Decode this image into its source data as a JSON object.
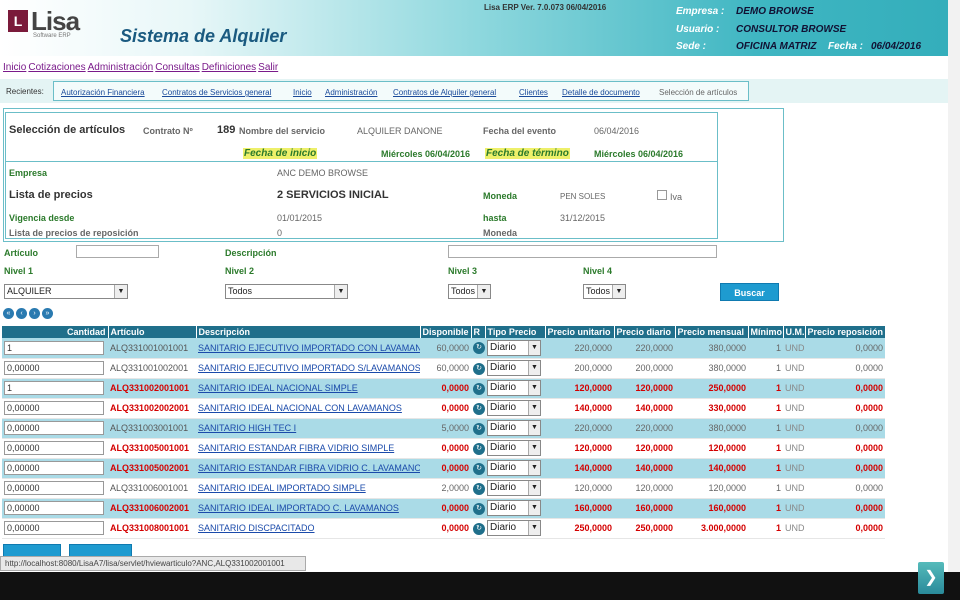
{
  "header": {
    "logo": "Lisa",
    "logo_sub": "Software ERP",
    "app_title": "Sistema de Alquiler",
    "version": "Lisa ERP Ver. 7.0.073 06/04/2016",
    "empresa_label": "Empresa :",
    "empresa_value": "DEMO BROWSE",
    "usuario_label": "Usuario :",
    "usuario_value": "CONSULTOR BROWSE",
    "sede_label": "Sede :",
    "sede_value": "OFICINA MATRIZ",
    "fecha_label": "Fecha :",
    "fecha_value": "06/04/2016"
  },
  "menu": [
    "Inicio",
    "Cotizaciones",
    "Administración",
    "Consultas",
    "Definiciones",
    "Salir"
  ],
  "recientes": {
    "label": "Recientes:",
    "items": [
      "Autorización Financiera",
      "Contratos de Servicios general",
      "Inicio",
      "Administración",
      "Contratos de Alquiler general",
      "Clientes",
      "Detalle de documento"
    ],
    "current": "Selección de artículos"
  },
  "info": {
    "title": "Selección de artículos",
    "contrato_label": "Contrato Nº",
    "contrato_value": "189",
    "servicio_label": "Nombre del servicio",
    "servicio_value": "ALQUILER DANONE",
    "evento_label": "Fecha del evento",
    "evento_value": "06/04/2016",
    "inicio_label": "Fecha de inicio",
    "inicio_value": "Miércoles 06/04/2016",
    "termino_label": "Fecha de término",
    "termino_value": "Miércoles 06/04/2016",
    "empresa_label": "Empresa",
    "empresa_value": "ANC DEMO BROWSE",
    "lista_label": "Lista de precios",
    "lista_value": "2 SERVICIOS INICIAL",
    "moneda_label": "Moneda",
    "moneda_value": "PEN SOLES",
    "iva_label": "Iva",
    "vigencia_label": "Vigencia desde",
    "vigencia_value": "01/01/2015",
    "hasta_label": "hasta",
    "hasta_value": "31/12/2015",
    "reposicion_label": "Lista de precios de reposición",
    "reposicion_value": "0",
    "moneda2_label": "Moneda"
  },
  "filters": {
    "articulo_label": "Artículo",
    "descripcion_label": "Descripción",
    "nivel1_label": "Nivel 1",
    "nivel1_value": "ALQUILER",
    "nivel2_label": "Nivel 2",
    "nivel2_value": "Todos",
    "nivel3_label": "Nivel 3",
    "nivel3_value": "Todos",
    "nivel4_label": "Nivel 4",
    "nivel4_value": "Todos",
    "buscar_label": "Buscar"
  },
  "table": {
    "columns": [
      "Cantidad",
      "Artículo",
      "Descripción",
      "Disponible",
      "R",
      "Tipo Precio",
      "Precio unitario",
      "Precio diario",
      "Precio mensual",
      "Mínimo",
      "U.M.",
      "Precio reposición"
    ],
    "rows": [
      {
        "qty": "1",
        "art": "ALQ331001001001",
        "desc": "SANITARIO EJECUTIVO IMPORTADO CON LAVAMANOS",
        "disp": "60,0000",
        "tipo": "Diario",
        "pu": "220,0000",
        "pd": "220,0000",
        "pm": "380,0000",
        "min": "1",
        "um": "UND",
        "pr": "0,0000",
        "red": false
      },
      {
        "qty": "0,00000",
        "art": "ALQ331001002001",
        "desc": "SANITARIO EJECUTIVO IMPORTADO S/LAVAMANOS",
        "disp": "60,0000",
        "tipo": "Diario",
        "pu": "200,0000",
        "pd": "200,0000",
        "pm": "380,0000",
        "min": "1",
        "um": "UND",
        "pr": "0,0000",
        "red": false
      },
      {
        "qty": "1",
        "art": "ALQ331002001001",
        "desc": "SANITARIO IDEAL NACIONAL SIMPLE",
        "disp": "0,0000",
        "tipo": "Diario",
        "pu": "120,0000",
        "pd": "120,0000",
        "pm": "250,0000",
        "min": "1",
        "um": "UND",
        "pr": "0,0000",
        "red": true
      },
      {
        "qty": "0,00000",
        "art": "ALQ331002002001",
        "desc": "SANITARIO IDEAL NACIONAL CON LAVAMANOS",
        "disp": "0,0000",
        "tipo": "Diario",
        "pu": "140,0000",
        "pd": "140,0000",
        "pm": "330,0000",
        "min": "1",
        "um": "UND",
        "pr": "0,0000",
        "red": true
      },
      {
        "qty": "0,00000",
        "art": "ALQ331003001001",
        "desc": "SANITARIO HIGH TEC I",
        "disp": "5,0000",
        "tipo": "Diario",
        "pu": "220,0000",
        "pd": "220,0000",
        "pm": "380,0000",
        "min": "1",
        "um": "UND",
        "pr": "0,0000",
        "red": false
      },
      {
        "qty": "0,00000",
        "art": "ALQ331005001001",
        "desc": "SANITARIO ESTANDAR FIBRA VIDRIO SIMPLE",
        "disp": "0,0000",
        "tipo": "Diario",
        "pu": "120,0000",
        "pd": "120,0000",
        "pm": "120,0000",
        "min": "1",
        "um": "UND",
        "pr": "0,0000",
        "red": true
      },
      {
        "qty": "0,00000",
        "art": "ALQ331005002001",
        "desc": "SANITARIO ESTANDAR FIBRA VIDRIO C. LAVAMANOS",
        "disp": "0,0000",
        "tipo": "Diario",
        "pu": "140,0000",
        "pd": "140,0000",
        "pm": "140,0000",
        "min": "1",
        "um": "UND",
        "pr": "0,0000",
        "red": true
      },
      {
        "qty": "0,00000",
        "art": "ALQ331006001001",
        "desc": "SANITARIO IDEAL IMPORTADO SIMPLE",
        "disp": "2,0000",
        "tipo": "Diario",
        "pu": "120,0000",
        "pd": "120,0000",
        "pm": "120,0000",
        "min": "1",
        "um": "UND",
        "pr": "0,0000",
        "red": false
      },
      {
        "qty": "0,00000",
        "art": "ALQ331006002001",
        "desc": "SANITARIO IDEAL IMPORTADO C. LAVAMANOS",
        "disp": "0,0000",
        "tipo": "Diario",
        "pu": "160,0000",
        "pd": "160,0000",
        "pm": "160,0000",
        "min": "1",
        "um": "UND",
        "pr": "0,0000",
        "red": true
      },
      {
        "qty": "0,00000",
        "art": "ALQ331008001001",
        "desc": "SANITARIO DISCPACITADO",
        "disp": "0,0000",
        "tipo": "Diario",
        "pu": "250,0000",
        "pd": "250,0000",
        "pm": "3.000,0000",
        "min": "1",
        "um": "UND",
        "pr": "0,0000",
        "red": true
      }
    ]
  },
  "status": {
    "url": "http://localhost:8080/LisaA7/lisa/servlet/hviewarticulo?ANC,ALQ331002001001"
  }
}
